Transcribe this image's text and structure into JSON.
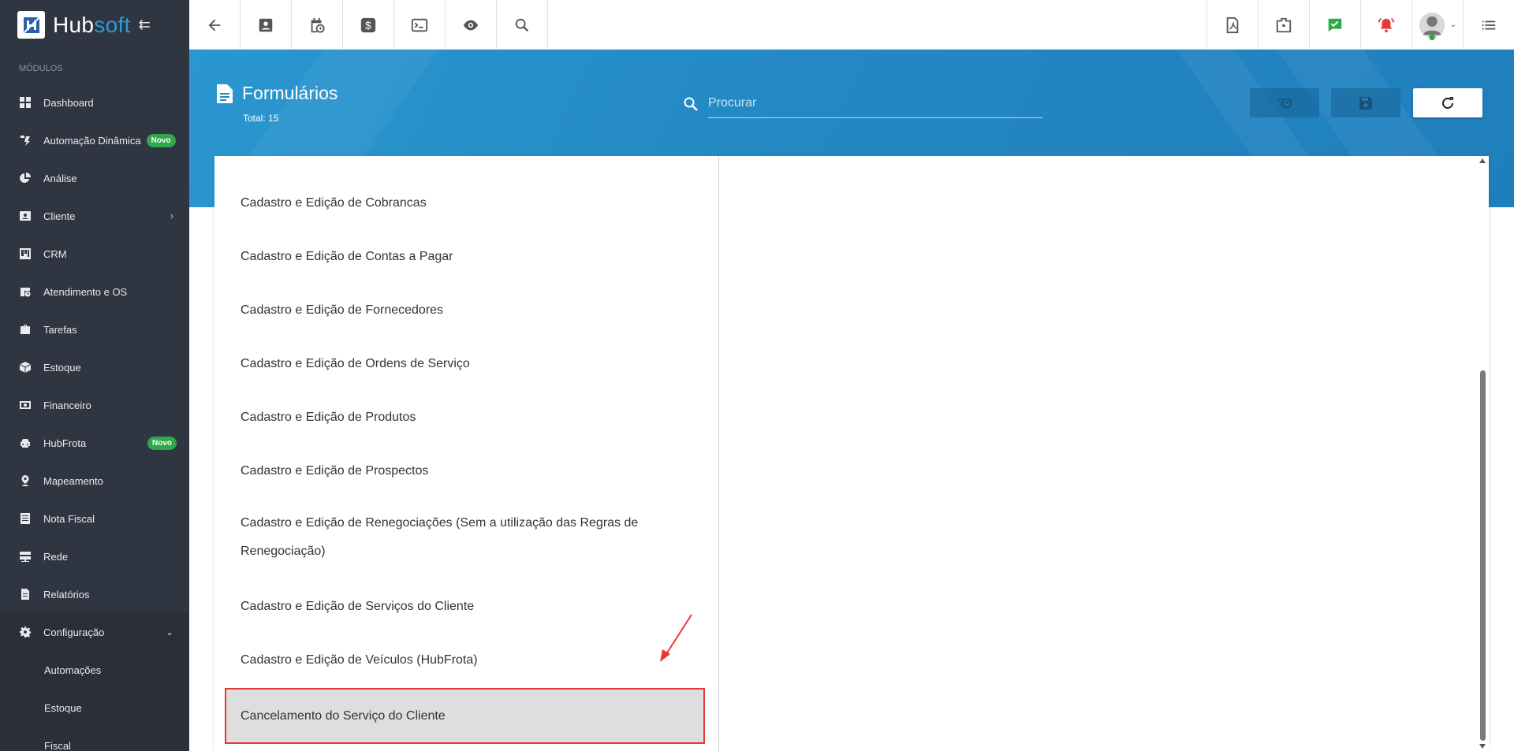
{
  "brand": {
    "name_a": "Hub",
    "name_b": "soft"
  },
  "sidebar": {
    "section_label": "MÓDULOS",
    "items": [
      {
        "label": "Dashboard",
        "icon": "dashboard-icon"
      },
      {
        "label": "Automação Dinâmica",
        "icon": "automation-icon",
        "badge": "Novo"
      },
      {
        "label": "Análise",
        "icon": "pie-chart-icon"
      },
      {
        "label": "Cliente",
        "icon": "contact-card-icon"
      },
      {
        "label": "CRM",
        "icon": "kanban-icon"
      },
      {
        "label": "Atendimento e OS",
        "icon": "calendar-clock-icon"
      },
      {
        "label": "Tarefas",
        "icon": "briefcase-icon"
      },
      {
        "label": "Estoque",
        "icon": "box-icon"
      },
      {
        "label": "Financeiro",
        "icon": "money-icon"
      },
      {
        "label": "HubFrota",
        "icon": "car-icon",
        "badge": "Novo"
      },
      {
        "label": "Mapeamento",
        "icon": "map-pin-icon"
      },
      {
        "label": "Nota Fiscal",
        "icon": "invoice-icon"
      },
      {
        "label": "Rede",
        "icon": "server-icon"
      },
      {
        "label": "Relatórios",
        "icon": "report-icon"
      },
      {
        "label": "Configuração",
        "icon": "gear-icon"
      }
    ],
    "sub_items": [
      {
        "label": "Automações"
      },
      {
        "label": "Estoque"
      },
      {
        "label": "Fiscal"
      }
    ]
  },
  "header": {
    "title": "Formulários",
    "total": "Total: 15",
    "search_placeholder": "Procurar"
  },
  "forms": [
    "Cadastro e Edição de Cobrancas",
    "Cadastro e Edição de Contas a Pagar",
    "Cadastro e Edição de Fornecedores",
    "Cadastro e Edição de Ordens de Serviço",
    "Cadastro e Edição de Produtos",
    "Cadastro e Edição de Prospectos",
    "Cadastro e Edição de Renegociações (Sem a utilização das Regras de Renegociação)",
    "Cadastro e Edição de Serviços do Cliente",
    "Cadastro e Edição de Veículos (HubFrota)",
    "Cancelamento do Serviço do Cliente"
  ],
  "selected_form": "Cancelamento do Serviço do Cliente",
  "colors": {
    "sidebar": "#303641",
    "header": "#2388c4",
    "accent": "#2d9ad8",
    "badge": "#2ea84a",
    "highlight": "#e53935"
  }
}
